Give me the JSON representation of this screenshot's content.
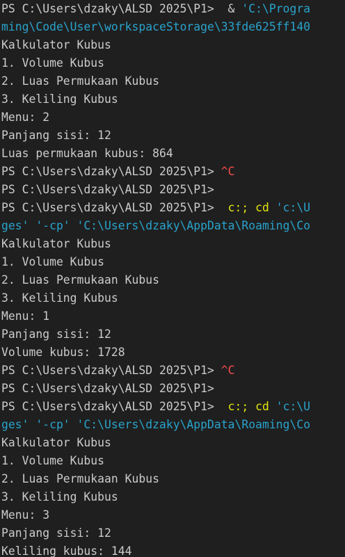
{
  "terminal": {
    "colors": {
      "background": "#1f1f1f",
      "default": "#cccccc",
      "yellow": "#e5e510",
      "cyan": "#29a3cc",
      "red": "#f14c4c"
    },
    "lines": [
      [
        {
          "t": "PS C:\\Users\\dzaky\\ALSD 2025\\P1>  & ",
          "c": "default"
        },
        {
          "t": "'C:\\Progra",
          "c": "cyan"
        }
      ],
      [
        {
          "t": "ming\\Code\\User\\workspaceStorage\\33fde625ff140",
          "c": "cyan"
        }
      ],
      [
        {
          "t": "Kalkulator Kubus",
          "c": "default"
        }
      ],
      [
        {
          "t": "1. Volume Kubus",
          "c": "default"
        }
      ],
      [
        {
          "t": "2. Luas Permukaan Kubus",
          "c": "default"
        }
      ],
      [
        {
          "t": "3. Keliling Kubus",
          "c": "default"
        }
      ],
      [
        {
          "t": "Menu: 2",
          "c": "default"
        }
      ],
      [
        {
          "t": "Panjang sisi: 12",
          "c": "default"
        }
      ],
      [
        {
          "t": "Luas permukaan kubus: 864",
          "c": "default"
        }
      ],
      [
        {
          "t": "PS C:\\Users\\dzaky\\ALSD 2025\\P1> ",
          "c": "default"
        },
        {
          "t": "^C",
          "c": "red"
        }
      ],
      [
        {
          "t": "PS C:\\Users\\dzaky\\ALSD 2025\\P1>",
          "c": "default"
        }
      ],
      [
        {
          "t": "PS C:\\Users\\dzaky\\ALSD 2025\\P1>  ",
          "c": "default"
        },
        {
          "t": "c:; cd ",
          "c": "yellow"
        },
        {
          "t": "'c:\\U",
          "c": "cyan"
        }
      ],
      [
        {
          "t": "ges' '-cp' 'C:\\Users\\dzaky\\AppData\\Roaming\\Co",
          "c": "cyan"
        }
      ],
      [
        {
          "t": "Kalkulator Kubus",
          "c": "default"
        }
      ],
      [
        {
          "t": "1. Volume Kubus",
          "c": "default"
        }
      ],
      [
        {
          "t": "2. Luas Permukaan Kubus",
          "c": "default"
        }
      ],
      [
        {
          "t": "3. Keliling Kubus",
          "c": "default"
        }
      ],
      [
        {
          "t": "Menu: 1",
          "c": "default"
        }
      ],
      [
        {
          "t": "Panjang sisi: 12",
          "c": "default"
        }
      ],
      [
        {
          "t": "Volume kubus: 1728",
          "c": "default"
        }
      ],
      [
        {
          "t": "PS C:\\Users\\dzaky\\ALSD 2025\\P1> ",
          "c": "default"
        },
        {
          "t": "^C",
          "c": "red"
        }
      ],
      [
        {
          "t": "PS C:\\Users\\dzaky\\ALSD 2025\\P1>",
          "c": "default"
        }
      ],
      [
        {
          "t": "PS C:\\Users\\dzaky\\ALSD 2025\\P1>  ",
          "c": "default"
        },
        {
          "t": "c:; cd ",
          "c": "yellow"
        },
        {
          "t": "'c:\\U",
          "c": "cyan"
        }
      ],
      [
        {
          "t": "ges' '-cp' 'C:\\Users\\dzaky\\AppData\\Roaming\\Co",
          "c": "cyan"
        }
      ],
      [
        {
          "t": "Kalkulator Kubus",
          "c": "default"
        }
      ],
      [
        {
          "t": "1. Volume Kubus",
          "c": "default"
        }
      ],
      [
        {
          "t": "2. Luas Permukaan Kubus",
          "c": "default"
        }
      ],
      [
        {
          "t": "3. Keliling Kubus",
          "c": "default"
        }
      ],
      [
        {
          "t": "Menu: 3",
          "c": "default"
        }
      ],
      [
        {
          "t": "Panjang sisi: 12",
          "c": "default"
        }
      ],
      [
        {
          "t": "Keliling kubus: 144",
          "c": "default"
        }
      ]
    ]
  }
}
